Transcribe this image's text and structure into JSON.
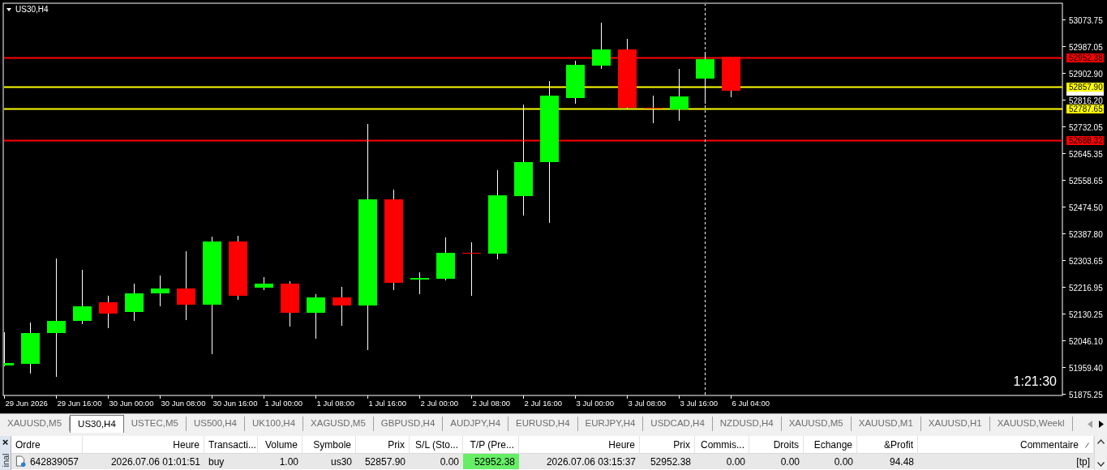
{
  "chart": {
    "title": "US30,H4",
    "countdown": "1:21:30",
    "price_lines": [
      {
        "label": "52952.38",
        "color": "#ff0000"
      },
      {
        "label": "52857.90",
        "color": "#ffff00"
      },
      {
        "label": "52787.65",
        "color": "#ffff00"
      },
      {
        "label": "52688.32",
        "color": "#ff0000"
      }
    ],
    "price_axis": [
      "53073.75",
      "52987.05",
      "52902.90",
      "52816.20",
      "52732.05",
      "52645.35",
      "52558.65",
      "52474.50",
      "52387.80",
      "52303.65",
      "52216.95",
      "52130.25",
      "52046.10",
      "51959.40",
      "51875.25"
    ],
    "time_axis": [
      "29 Jun 2026",
      "29 Jun 16:00",
      "30 Jun 00:00",
      "30 Jun 08:00",
      "30 Jun 16:00",
      "1 Jul 00:00",
      "1 Jul 08:00",
      "1 Jul 16:00",
      "2 Jul 00:00",
      "2 Jul 08:00",
      "2 Jul 16:00",
      "3 Jul 00:00",
      "3 Jul 08:00",
      "3 Jul 16:00",
      "6 Jul 04:00"
    ]
  },
  "tabs": [
    {
      "label": "XAUUSD,M5",
      "selected": false
    },
    {
      "label": "US30,H4",
      "selected": true
    },
    {
      "label": "USTEC,M5",
      "selected": false
    },
    {
      "label": "US500,H4",
      "selected": false
    },
    {
      "label": "UK100,H4",
      "selected": false
    },
    {
      "label": "XAGUSD,M5",
      "selected": false
    },
    {
      "label": "GBPUSD,H4",
      "selected": false
    },
    {
      "label": "AUDJPY,H4",
      "selected": false
    },
    {
      "label": "EURUSD,H4",
      "selected": false
    },
    {
      "label": "EURJPY,H4",
      "selected": false
    },
    {
      "label": "USDCAD,H4",
      "selected": false
    },
    {
      "label": "NZDUSD,H4",
      "selected": false
    },
    {
      "label": "XAUUSD,M5",
      "selected": false
    },
    {
      "label": "XAUUSD,M1",
      "selected": false
    },
    {
      "label": "XAUUSD,H1",
      "selected": false
    },
    {
      "label": "XAUUSD,Weekl",
      "selected": false
    }
  ],
  "terminal": {
    "close": "×",
    "title": "inal",
    "table": {
      "columns": [
        "Ordre",
        "Heure",
        "Transacti...",
        "Volume",
        "Symbole",
        "Prix",
        "S/L (Sto...",
        "T/P (Pre...",
        "Heure",
        "Prix",
        "Commis...",
        "Droits",
        "Echange",
        "&Profit",
        "Commentaire"
      ],
      "rows": [
        {
          "cells": [
            {
              "text": "642839057",
              "highlighted": false
            },
            {
              "text": "2026.07.06 01:01:51",
              "highlighted": false
            },
            {
              "text": "buy",
              "highlighted": false
            },
            {
              "text": "1.00",
              "highlighted": false
            },
            {
              "text": "us30",
              "highlighted": false
            },
            {
              "text": "52857.90",
              "highlighted": false
            },
            {
              "text": "0.00",
              "highlighted": false
            },
            {
              "text": "52952.38",
              "highlighted": true
            },
            {
              "text": "2026.07.06 03:15:37",
              "highlighted": false
            },
            {
              "text": "52952.38",
              "highlighted": false
            },
            {
              "text": "0.00",
              "highlighted": false
            },
            {
              "text": "0.00",
              "highlighted": false
            },
            {
              "text": "0.00",
              "highlighted": false
            },
            {
              "text": "94.48",
              "highlighted": false
            },
            {
              "text": "[tp]",
              "highlighted": false
            }
          ]
        }
      ]
    }
  }
}
